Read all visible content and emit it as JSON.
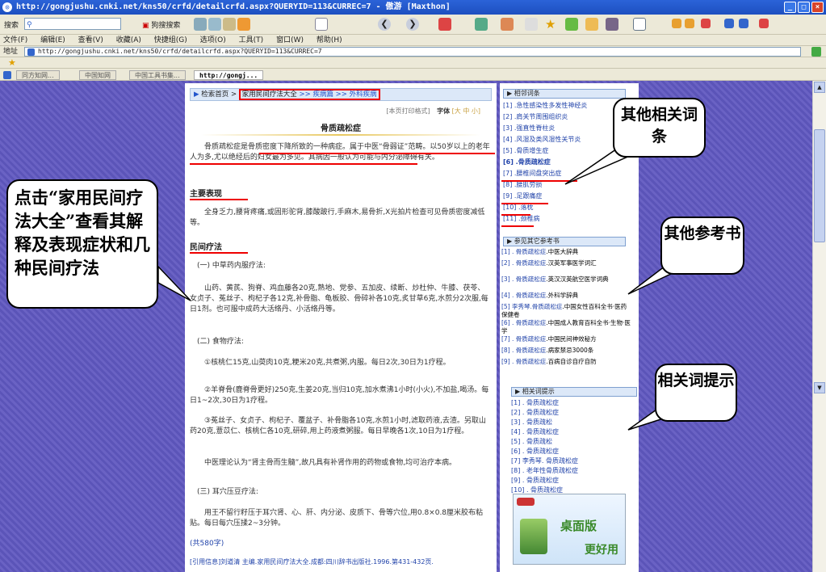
{
  "window": {
    "title": "http://gongjushu.cnki.net/kns50/crfd/detailcrfd.aspx?QUERYID=113&CURREC=7 - 傲游 [Maxthon]"
  },
  "toolbar": {
    "search_label": "搜索",
    "search_btn": "狗搜搜索"
  },
  "menu": [
    "文件(F)",
    "编辑(E)",
    "查看(V)",
    "收藏(A)",
    "快捷组(G)",
    "选项(O)",
    "工具(T)",
    "窗口(W)",
    "帮助(H)"
  ],
  "address": {
    "label": "地址",
    "url": "http://gongjushu.cnki.net/kns50/crfd/detailcrfd.aspx?QUERYID=113&CURREC=7"
  },
  "tabs": [
    "同方知网...",
    "中国知网",
    "中国工具书集...",
    "http://gongj..."
  ],
  "breadcrumb": {
    "home": "检索首页 >",
    "book": "家用民间疗法大全",
    "rest": ">> 疾病篇 >> 外科疾病"
  },
  "doc": {
    "print": "[本页打印格式]",
    "font_label": "字体",
    "font_sizes": "[大 中 小]",
    "title": "骨质疏松症",
    "intro": "骨质疏松症是骨质密度下降所致的一种病症。属于中医“骨弱证”范畴。以50岁以上的老年人为多,尤以绝经后的妇女最为多见。其病因一般认为可能与内分泌障碍有关。",
    "h_symptoms": "主要表现",
    "symptoms": "全身乏力,腰背疼痛,或固形驼背,膝酸跛行,手麻木,易骨折,X光拍片检查可见骨质密度减低等。",
    "h_remedies": "民间疗法",
    "sub1": "(一) 中草药内服疗法:",
    "rx1": "山药、黄芪、狗脊、鸡血藤各20克,熟地、党参、五加皮、续断、炒杜仲、牛膝、茯苓、女贞子、菟丝子、枸杞子各12克,补骨脂、龟板胶、骨碎补各10克,炙甘草6克,水煎分2次服,每日1剂。也可服中成药大活络丹、小活络丹等。",
    "sub2": "(二) 食物疗法:",
    "food1": "①核桃仁15克,山萸肉10克,粳米20克,共煮粥,内服。每日2次,30日为1疗程。",
    "food2": "②羊脊骨(鹿脊骨更好)250克,生姜20克,当归10克,加水煮沸1小时(小火),不加盐,喝汤。每日1~2次,30日为1疗程。",
    "food3": "③菟丝子、女贞子、枸杞子、覆盆子、补骨脂各10克,水煎1小时,滤取药液,去渣。另取山药20克,薏苡仁、核桃仁各10克,研碎,用上药液煮粥服。每日早晚各1次,10日为1疗程。",
    "theory": "中医理论认为“肾主骨而生髓”,故凡具有补肾作用的药物或食物,均可治疗本病。",
    "sub3": "(三) 耳穴压豆疗法:",
    "ear": "用王不留行籽压于耳穴肾、心、肝、内分泌、皮质下、骨等穴位,用0.8×0.8厘米胶布粘贴。每日每穴压揉2~3分钟。",
    "count": "(共580字)",
    "citation": "[引用信息]刘道清 主编.家用民间疗法大全.成都:四川辞书出版社.1996.第431-432页."
  },
  "side": {
    "related_header": "相邻词条",
    "related": [
      "[1] .急性感染性多发性神经炎",
      "[2] .肩关节周围组织炎",
      "[3] .强直性脊柱炎",
      "[4] .风湿及类风湿性关节炎",
      "[5] .骨质增生症",
      "[6] .骨质疏松症",
      "[7] .腰椎间盘突出症",
      "[8] .腰肌劳损",
      "[9] .足跟痛症",
      "[10] .落枕",
      "[11] .颈椎病"
    ],
    "refs_header": "参见其它参考书",
    "refs": [
      {
        "pre": "[1] . ",
        "term": "骨质疏松症",
        "book": ".中医大辞典"
      },
      {
        "pre": "[2] . ",
        "term": "骨质疏松症",
        "book": ".汉英军事医学词汇"
      },
      {
        "pre": "[3] . ",
        "term": "骨质疏松症",
        "book": ".英汉汉英航空医学词典"
      },
      {
        "pre": "[4] . ",
        "term": "骨质疏松症",
        "book": ".外科学辞典"
      },
      {
        "pre": "[5] ",
        "term": "李秀琴.骨质疏松症",
        "book": ".中国女性百科全书·医药保健卷"
      },
      {
        "pre": "[6] . ",
        "term": "骨质疏松症",
        "book": ".中国成人教育百科全书·生物·医学"
      },
      {
        "pre": "[7] . ",
        "term": "骨质疏松症",
        "book": ".中国民间神效秘方"
      },
      {
        "pre": "[8] . ",
        "term": "骨质疏松症",
        "book": ".病家禁忌3000条"
      },
      {
        "pre": "[9] . ",
        "term": "骨质疏松症",
        "book": ".百病自诊自疗自防"
      }
    ],
    "hints_header": "相关词提示",
    "hints": [
      "[1] . 骨质疏松症",
      "[2] . 骨质疏松症",
      "[3] . 骨质疏松",
      "[4] . 骨质疏松症",
      "[5] . 骨质疏松",
      "[6] . 骨质疏松症",
      "[7] 李秀琴. 骨质疏松症",
      "[8] . 老年性骨质疏松症",
      "[9] . 骨质疏松症",
      "[10] . 骨质疏松症"
    ],
    "banner": {
      "line1": "桌面版",
      "line2": "更好用"
    }
  },
  "callouts": {
    "c1": "点击“家用民间疗法大全”查看其解释及表现症状和几种民间疗法",
    "c2": "其他相关词条",
    "c3": "其他参考书",
    "c4": "相关词提示"
  }
}
